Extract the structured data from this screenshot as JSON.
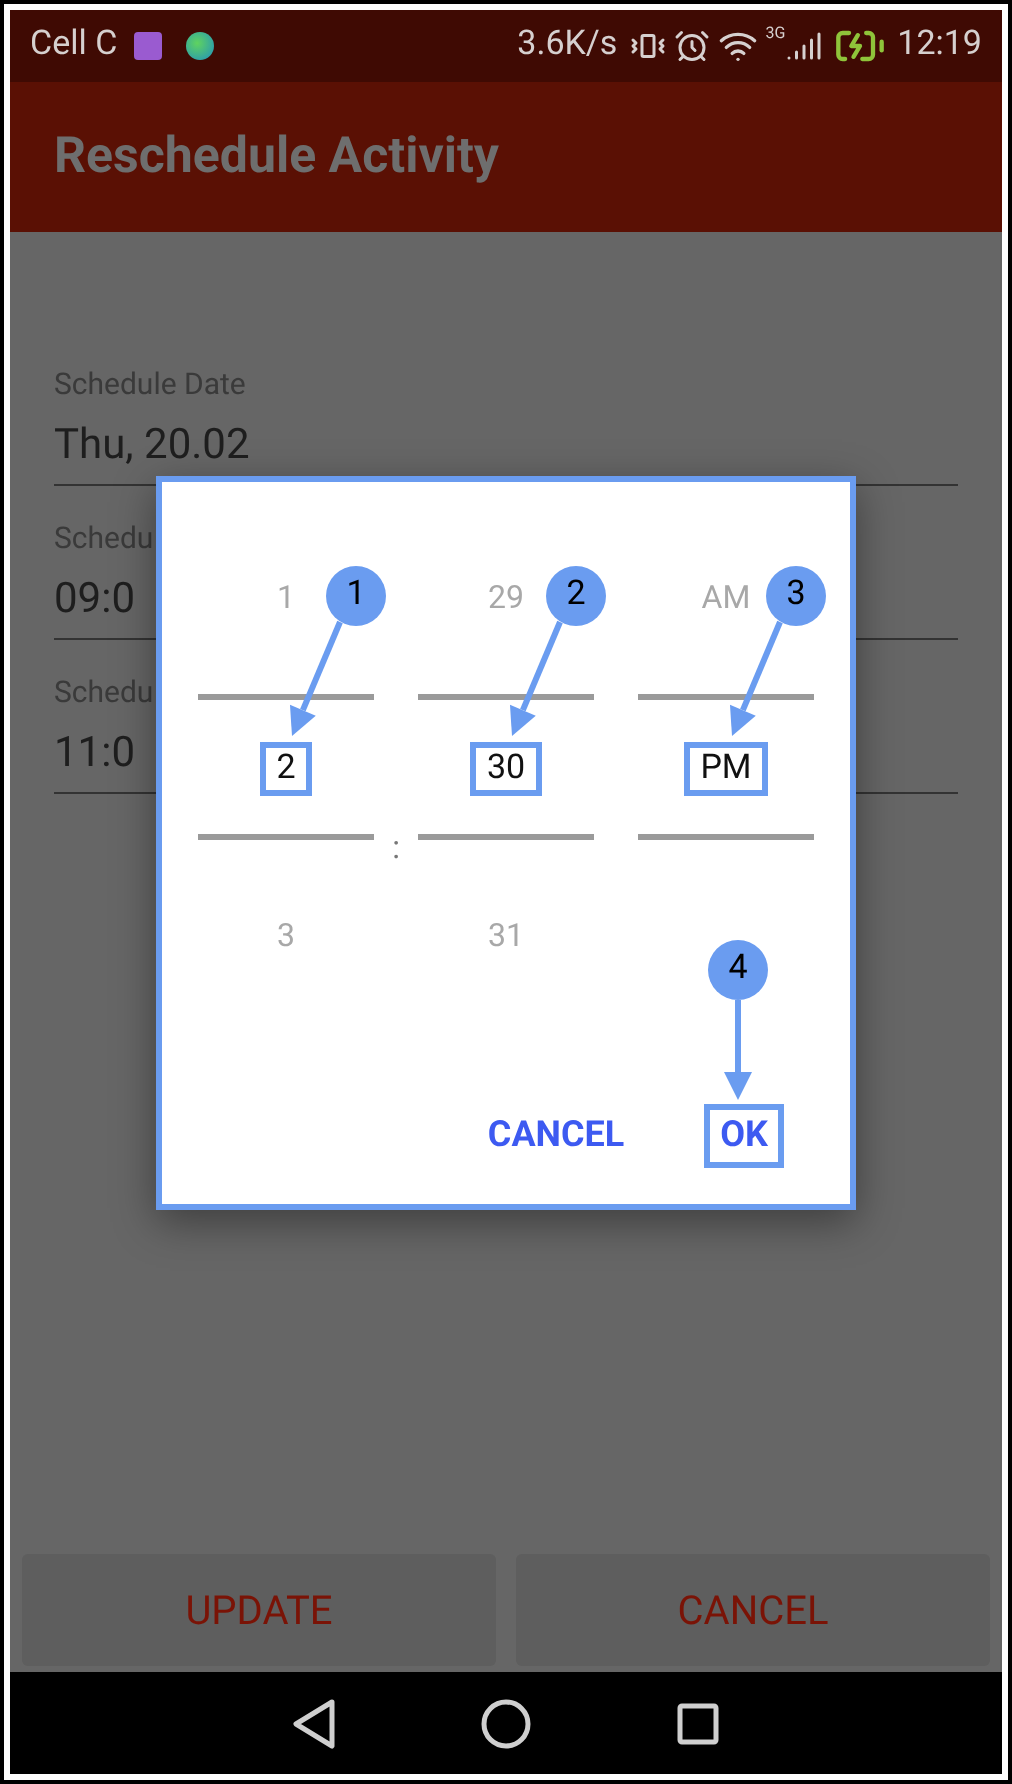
{
  "status_bar": {
    "carrier": "Cell C",
    "net_speed": "3.6K/s",
    "network_type": "3G",
    "time": "12:19"
  },
  "app_bar": {
    "title": "Reschedule Activity"
  },
  "fields": [
    {
      "label": "Schedule Date",
      "value": "Thu, 20.02"
    },
    {
      "label": "Schedu",
      "value": "09:0"
    },
    {
      "label": "Schedu",
      "value": "11:0"
    }
  ],
  "time_picker": {
    "columns": [
      {
        "above": "1",
        "value": "2",
        "below": "3"
      },
      {
        "above": "29",
        "value": "30",
        "below": "31"
      },
      {
        "above": "AM",
        "value": "PM"
      }
    ],
    "separator": ":",
    "buttons": [
      "CANCEL",
      "OK"
    ]
  },
  "callouts": [
    "1",
    "2",
    "3",
    "4"
  ],
  "footer_buttons": [
    "UPDATE",
    "CANCEL"
  ]
}
